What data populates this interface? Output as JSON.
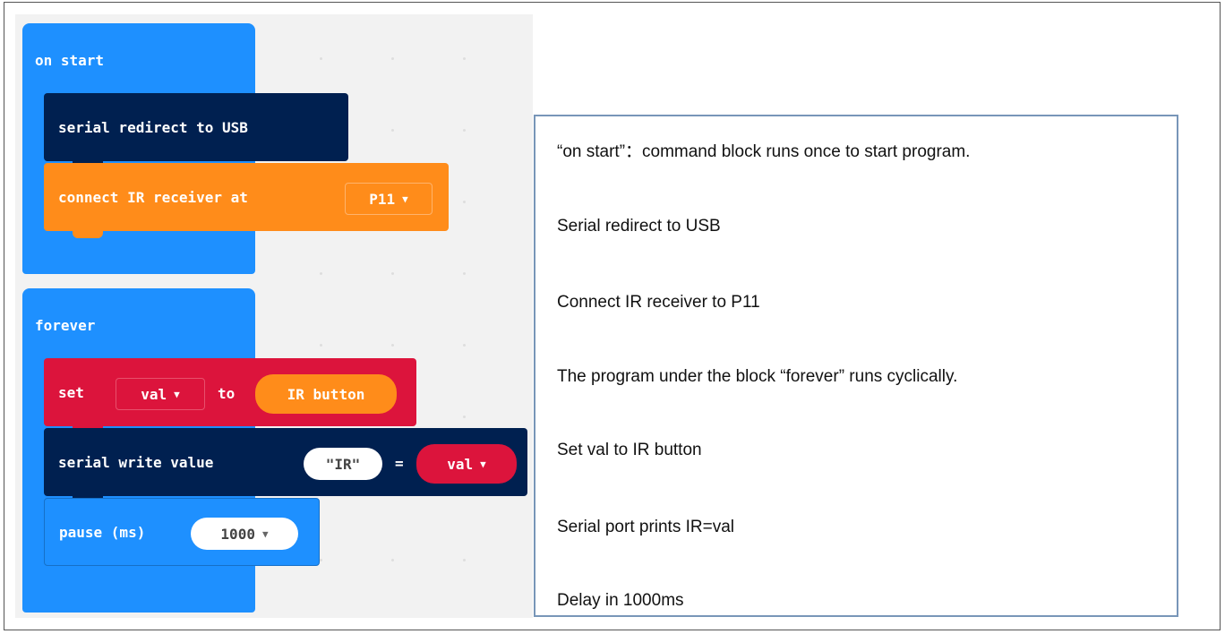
{
  "blocks": {
    "on_start": {
      "label": "on start"
    },
    "serial_redirect": {
      "label": "serial redirect to USB"
    },
    "connect_ir": {
      "label": "connect IR receiver at",
      "pin": "P11"
    },
    "forever": {
      "label": "forever"
    },
    "set_var": {
      "set_label": "set",
      "var": "val",
      "to_label": "to",
      "value": "IR button"
    },
    "serial_write": {
      "label": "serial write value",
      "name": "\"IR\"",
      "eq": "=",
      "var": "val"
    },
    "pause": {
      "label": "pause (ms)",
      "value": "1000"
    }
  },
  "explanations": [
    "“on start”：command block runs once to start program.",
    "Serial redirect to USB",
    "Connect IR receiver to P11",
    "The program under the block  “forever”  runs cyclically.",
    "Set val to IR button",
    "Serial port prints IR=val",
    "Delay in 1000ms"
  ],
  "colors": {
    "basic_blue": "#1e90ff",
    "serial_navy": "#002050",
    "ir_orange": "#ff8c1a",
    "variables_red": "#dc143c",
    "frame_border": "#7896b8"
  }
}
